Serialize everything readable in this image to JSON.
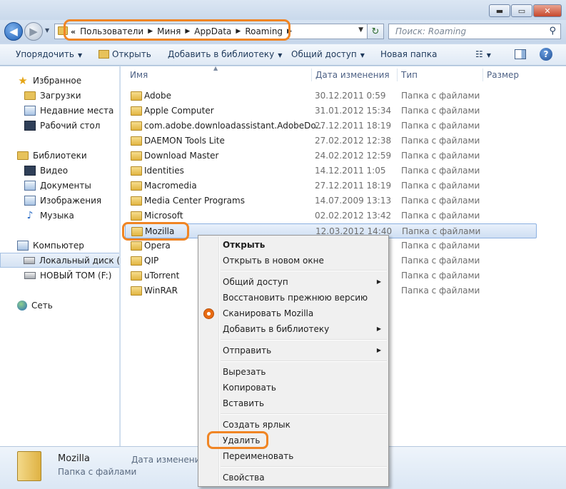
{
  "window": {
    "minimize": "▬",
    "maximize": "▭",
    "close": "✕"
  },
  "nav": {
    "back": "◀",
    "forward": "▶",
    "history": "▼",
    "breadcrumb_lead": "«",
    "breadcrumbs": [
      "Пользователи",
      "Миня",
      "AppData",
      "Roaming"
    ],
    "breadcrumb_sep": "▶",
    "address_dropdown": "▼",
    "refresh_glyph": "↻",
    "search_placeholder": "Поиск: Roaming",
    "search_glyph": "⚲"
  },
  "toolbar": {
    "organize": "Упорядочить",
    "open": "Открыть",
    "add_to_library": "Добавить в библиотеку",
    "share": "Общий доступ",
    "new_folder": "Новая папка",
    "caret": "▼",
    "views_glyph": "☷",
    "help": "?"
  },
  "sidebar": {
    "favorites": "Избранное",
    "downloads": "Загрузки",
    "recent": "Недавние места",
    "desktop": "Рабочий стол",
    "libraries": "Библиотеки",
    "video": "Видео",
    "documents": "Документы",
    "images": "Изображения",
    "music": "Музыка",
    "computer": "Компьютер",
    "local_disk": "Локальный диск (С",
    "new_volume": "НОВЫЙ ТОМ (F:)",
    "network": "Сеть"
  },
  "columns": {
    "name": "Имя",
    "date": "Дата изменения",
    "type": "Тип",
    "size": "Размер",
    "sort_glyph": "▲"
  },
  "files": [
    {
      "name": "Adobe",
      "date": "30.12.2011 0:59",
      "type": "Папка с файлами"
    },
    {
      "name": "Apple Computer",
      "date": "31.01.2012 15:34",
      "type": "Папка с файлами"
    },
    {
      "name": "com.adobe.downloadassistant.AdobeDo...",
      "date": "27.12.2011 18:19",
      "type": "Папка с файлами"
    },
    {
      "name": "DAEMON Tools Lite",
      "date": "27.02.2012 12:38",
      "type": "Папка с файлами"
    },
    {
      "name": "Download Master",
      "date": "24.02.2012 12:59",
      "type": "Папка с файлами"
    },
    {
      "name": "Identities",
      "date": "14.12.2011 1:05",
      "type": "Папка с файлами"
    },
    {
      "name": "Macromedia",
      "date": "27.12.2011 18:19",
      "type": "Папка с файлами"
    },
    {
      "name": "Media Center Programs",
      "date": "14.07.2009 13:13",
      "type": "Папка с файлами"
    },
    {
      "name": "Microsoft",
      "date": "02.02.2012 13:42",
      "type": "Папка с файлами"
    },
    {
      "name": "Mozilla",
      "date": "12.03.2012 14:40",
      "type": "Папка с файлами"
    },
    {
      "name": "Opera",
      "date": "",
      "type": "Папка с файлами"
    },
    {
      "name": "QIP",
      "date": "",
      "type": "Папка с файлами"
    },
    {
      "name": "uTorrent",
      "date": "",
      "type": "Папка с файлами"
    },
    {
      "name": "WinRAR",
      "date": "",
      "type": "Папка с файлами"
    }
  ],
  "context_menu": {
    "open": "Открыть",
    "open_new_window": "Открыть в новом окне",
    "share": "Общий доступ",
    "restore": "Восстановить прежнюю версию",
    "scan": "Сканировать Mozilla",
    "add_library": "Добавить в библиотеку",
    "send_to": "Отправить",
    "cut": "Вырезать",
    "copy": "Копировать",
    "paste": "Вставить",
    "shortcut": "Создать ярлык",
    "delete": "Удалить",
    "rename": "Переименовать",
    "properties": "Свойства",
    "arrow": "▶"
  },
  "details": {
    "name": "Mozilla",
    "type": "Папка с файлами",
    "date_label": "Дата изменения:"
  },
  "colors": {
    "highlight_ring": "#f08524",
    "selection": "#cfdff3"
  }
}
